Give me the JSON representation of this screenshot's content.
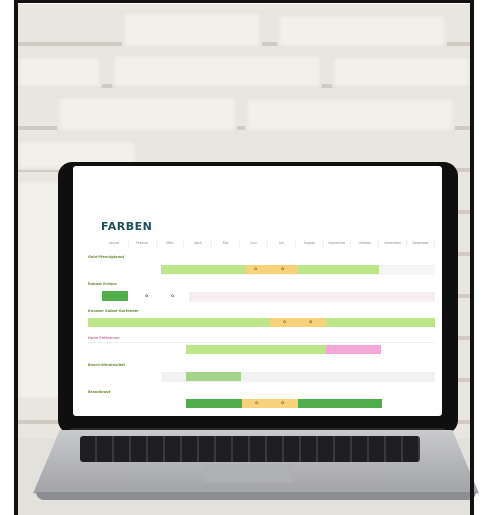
{
  "scene": {
    "description_kind": "laptop on table against painted brick wall",
    "colors": {
      "light_green": "#bde58a",
      "dark_green": "#4fae4a",
      "orange": "#f7d27a",
      "pink": "#f2a7d6",
      "gray_track": "#eeeeee"
    }
  },
  "screen": {
    "title": "FARBEN",
    "months": [
      "Januar",
      "Februar",
      "März",
      "April",
      "Mai",
      "Juni",
      "Juli",
      "August",
      "September",
      "Oktober",
      "November",
      "Dezember"
    ],
    "rows": [
      {
        "label": "Gold-Pfennigkraut"
      },
      {
        "label": "Robust Erdnus"
      },
      {
        "label": "Knusser Salbei-Gartender"
      },
      {
        "label": "Hohe Fetthenne"
      },
      {
        "label": "Busch-Windrosllelt"
      },
      {
        "label": "Brandkraut"
      }
    ]
  }
}
